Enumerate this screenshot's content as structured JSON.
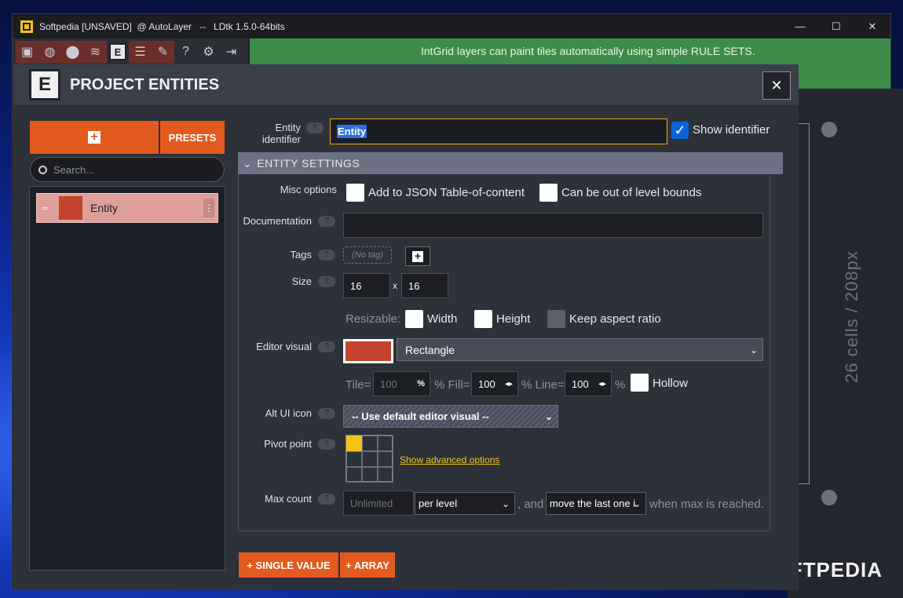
{
  "window": {
    "title": "Softpedia [UNSAVED]  @ AutoLayer   --   LDtk 1.5.0-64bits",
    "controls": [
      "—",
      "☐",
      "✕"
    ]
  },
  "toolbar": {
    "icons": [
      "project-settings-icon",
      "world-icon",
      "level-icon",
      "layers-icon",
      "entities-icon",
      "enums-icon",
      "tilesets-icon",
      "help-icon",
      "settings-icon",
      "exit-icon"
    ],
    "active": "entities-icon"
  },
  "banner": {
    "text": "IntGrid layers can paint tiles automatically using simple RULE SETS."
  },
  "canvas": {
    "dimension_text": "26 cells / 208px"
  },
  "watermark": "SOFTPEDIA",
  "panel": {
    "title": "PROJECT ENTITIES",
    "close": "✕",
    "add_plus": "+",
    "presets": "PRESETS",
    "search_placeholder": "Search...",
    "entities": [
      {
        "name": "Entity",
        "color": "#c3432c"
      }
    ]
  },
  "form": {
    "identifier_label": "Entity identifier",
    "identifier_value": "Entity",
    "show_identifier_label": "Show identifier",
    "show_identifier_checked": true,
    "help": "?",
    "section_title": "ENTITY SETTINGS",
    "misc_label": "Misc options",
    "misc_add_json": "Add to JSON Table-of-content",
    "misc_out_bounds": "Can be out of level bounds",
    "doc_label": "Documentation",
    "tags_label": "Tags",
    "no_tag": "(No tag)",
    "size_label": "Size",
    "size_w": "16",
    "size_x": "x",
    "size_h": "16",
    "resizable_label": "Resizable:",
    "width_label": "Width",
    "height_label": "Height",
    "keep_aspect_label": "Keep aspect ratio",
    "editor_visual_label": "Editor visual",
    "editor_visual_value": "Rectangle",
    "tile_label": "Tile=",
    "tile_value": "100",
    "pct": "%",
    "fill_label": "% Fill=",
    "fill_value": "100",
    "line_label": "% Line=",
    "line_value": "100",
    "hollow_label": "Hollow",
    "alt_icon_label": "Alt UI icon",
    "alt_icon_value": "-- Use default editor visual --",
    "pivot_label": "Pivot point",
    "advanced_link": "Show advanced options",
    "max_count_label": "Max count",
    "max_count_placeholder": "Unlimited",
    "per_level": "per level",
    "and": ", and",
    "move_last": "move the last one i",
    "max_reached": "when max is reached.",
    "single_value": "+ SINGLE VALUE",
    "array": "+ ARRAY"
  }
}
